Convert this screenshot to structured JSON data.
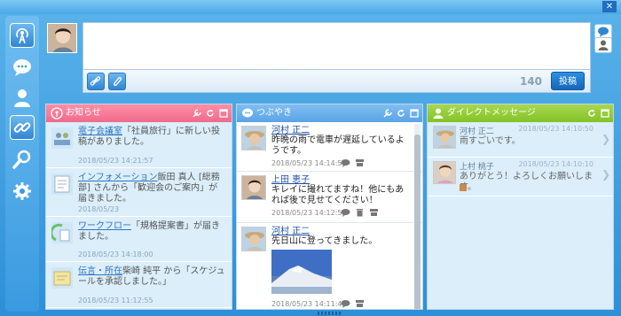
{
  "window": {
    "close_label": "✕"
  },
  "composer": {
    "text_value": "",
    "char_count": "140",
    "post_label": "投稿"
  },
  "announcements": {
    "title": "お知らせ",
    "items": [
      {
        "link": "電子会議室",
        "text": "「社員旅行」に新しい投稿がありました。",
        "date": "2018/05/23 14:21:57"
      },
      {
        "link": "インフォメーション",
        "text": "飯田 真人 [総務部] さんから「歓迎会のご案内」が届きました。",
        "date": "2018/05/23"
      },
      {
        "link": "ワークフロー",
        "text": "「規格提案書」が届きました。",
        "date": "2018/05/23 14:18:00"
      },
      {
        "link": "伝言・所在",
        "text": "柴崎 純平 から「スケジュールを承認しました。」",
        "date": "2018/05/23 11:12:55"
      }
    ]
  },
  "tweets": {
    "title": "つぶやき",
    "items": [
      {
        "name": "河村 正二",
        "text": "昨晩の雨で電車が遅延しているようです。",
        "date": "2018/05/23 14:14:56"
      },
      {
        "name": "上田 恵子",
        "text": "キレイに撮れてますね！他にもあれば後で見せてください！",
        "date": "2018/05/23 14:12:51"
      },
      {
        "name": "河村 正二",
        "text": "先日山に登ってきました。",
        "date": "2018/05/23 14:11:46"
      }
    ]
  },
  "direct_messages": {
    "title": "ダイレクトメッセージ",
    "items": [
      {
        "name": "河村 正二",
        "date": "2018/05/23 14:10:50",
        "text": "雨すごいです。"
      },
      {
        "name": "上村 桃子",
        "date": "2018/05/23 14:10:10",
        "text": "ありがとう！よろしくお願いします。"
      }
    ]
  }
}
